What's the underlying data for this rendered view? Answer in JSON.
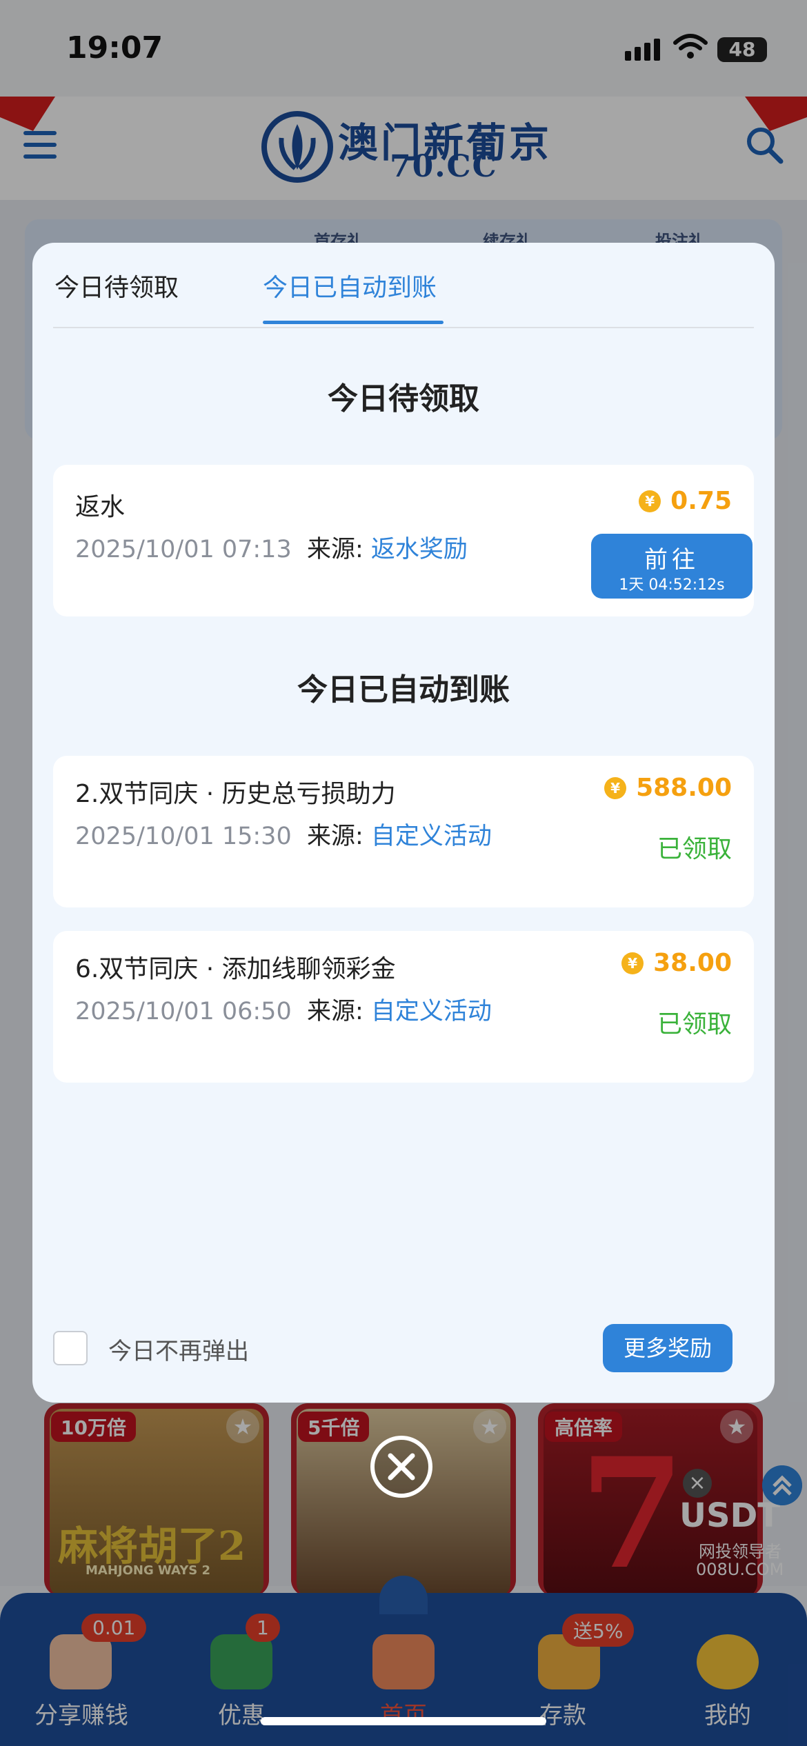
{
  "status": {
    "time": "19:07",
    "battery": "48"
  },
  "header": {
    "logo_title": "澳门新葡京",
    "logo_sub": "70.CC"
  },
  "background": {
    "banner_tabs": [
      "首存礼",
      "续存礼",
      "投注礼"
    ],
    "games": [
      {
        "badge": "10万倍",
        "name": "麻将胡了2",
        "sub": "MAHJONG WAYS 2"
      },
      {
        "badge": "5千倍",
        "name": "",
        "sub": ""
      },
      {
        "badge": "高倍率",
        "name": "",
        "sub": ""
      }
    ],
    "usdt_label": "USDT",
    "usdt_sub": "网投领导者",
    "usdt_url": "008U.COM"
  },
  "modal": {
    "tabs": [
      {
        "label": "今日待领取",
        "active": false
      },
      {
        "label": "今日已自动到账",
        "active": true
      }
    ],
    "pending_title": "今日待领取",
    "pending": [
      {
        "title": "返水",
        "amount": "0.75",
        "time": "2025/10/01 07:13",
        "source_label": "来源:",
        "source": "返水奖励",
        "button": "前往",
        "countdown": "1天 04:52:12s"
      }
    ],
    "auto_title": "今日已自动到账",
    "auto": [
      {
        "title": "2.双节同庆 · 历史总亏损助力",
        "amount": "588.00",
        "time": "2025/10/01 15:30",
        "source_label": "来源:",
        "source": "自定义活动",
        "status": "已领取"
      },
      {
        "title": "6.双节同庆 · 添加线聊领彩金",
        "amount": "38.00",
        "time": "2025/10/01 06:50",
        "source_label": "来源:",
        "source": "自定义活动",
        "status": "已领取"
      }
    ],
    "no_show_label": "今日不再弹出",
    "more_button": "更多奖励",
    "coin_symbol": "¥"
  },
  "bottom_nav": {
    "items": [
      {
        "label": "分享赚钱",
        "badge": "0.01",
        "active": false
      },
      {
        "label": "优惠",
        "badge": "1",
        "active": false
      },
      {
        "label": "首页",
        "badge": "",
        "active": true
      },
      {
        "label": "存款",
        "badge": "送5%",
        "active": false
      },
      {
        "label": "我的",
        "badge": "",
        "active": false
      }
    ]
  },
  "colors": {
    "accent": "#2f83d9",
    "amount": "#f5a00f",
    "claimed": "#3ab23a",
    "nav_bg": "#1e4f9c"
  }
}
